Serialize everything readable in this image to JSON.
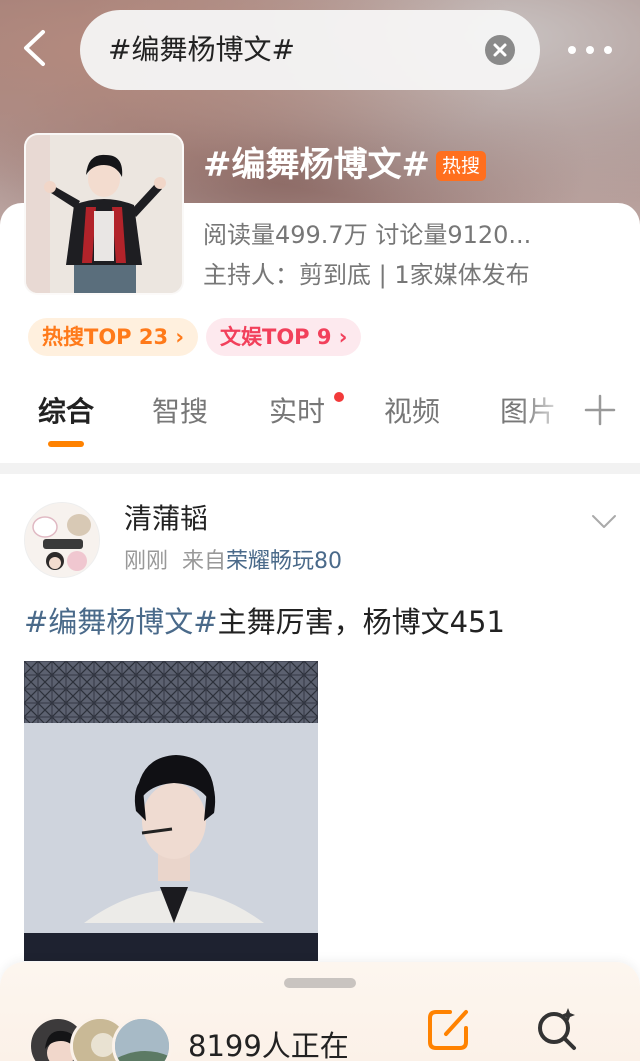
{
  "header": {
    "search_query": "#编舞杨博文#"
  },
  "topic": {
    "title": "#编舞杨博文#",
    "hot_badge": "热搜",
    "stats": "阅读量499.7万  讨论量9120...",
    "host": "主持人：剪到底 | 1家媒体发布",
    "rank_hot": "热搜TOP 23 ›",
    "rank_ent": "文娱TOP 9 ›"
  },
  "tabs": [
    {
      "label": "综合",
      "active": true
    },
    {
      "label": "智搜"
    },
    {
      "label": "实时",
      "has_dot": true
    },
    {
      "label": "视频"
    },
    {
      "label": "图片"
    }
  ],
  "post": {
    "author": "清蒲韬",
    "time": "刚刚",
    "from_prefix": "来自",
    "source": "荣耀畅玩80",
    "hashtag": "#编舞杨博文#",
    "body": "主舞厉害，杨博文451"
  },
  "bottom": {
    "online_text": "8199人正在"
  },
  "colors": {
    "accent": "#ff8200",
    "hot_badge": "#ff6f1e",
    "link": "#4a6a8a",
    "unread_dot": "#f23a3a"
  },
  "icons": {
    "back": "chevron-left-icon",
    "clear": "close-circle-icon",
    "more": "more-dots-icon",
    "add_tab": "plus-icon",
    "post_menu": "chevron-down-icon",
    "compose": "compose-icon",
    "smart_search": "smart-search-icon"
  }
}
